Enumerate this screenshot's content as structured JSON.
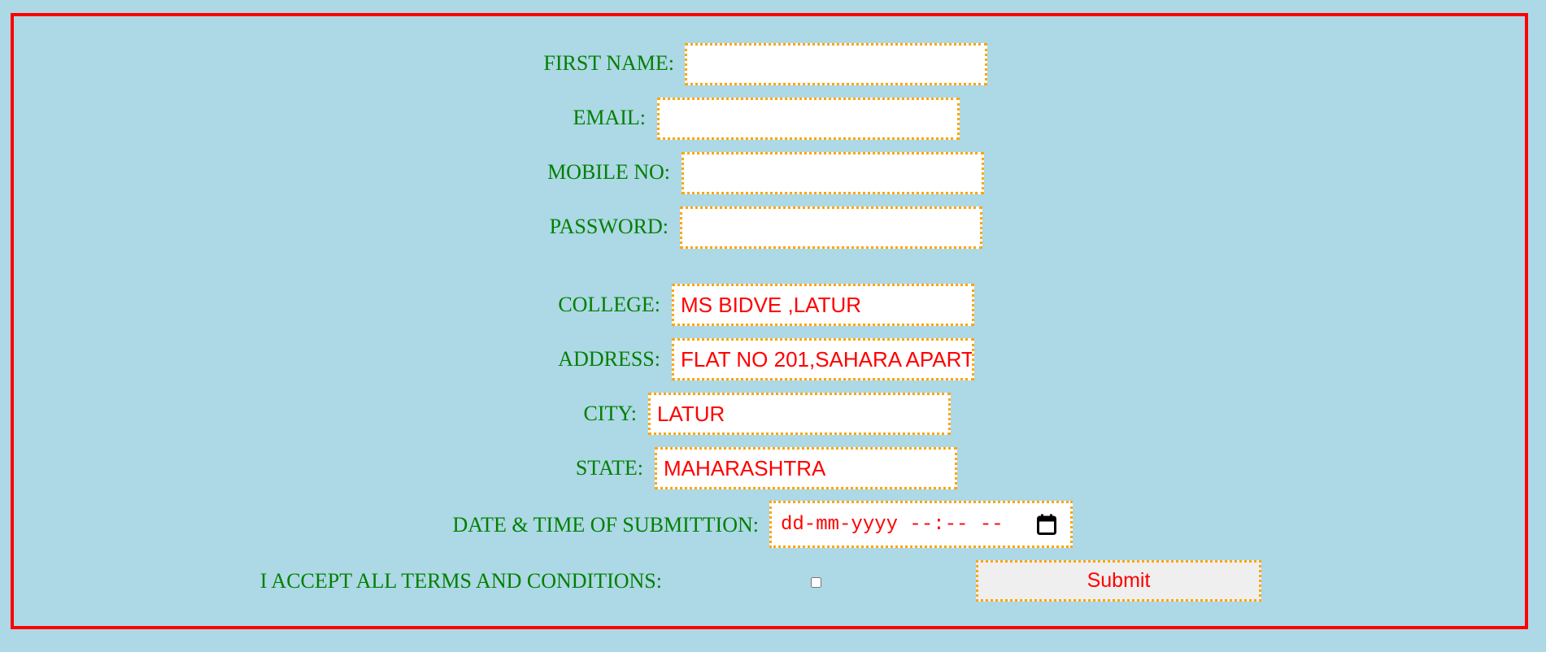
{
  "form": {
    "first_name": {
      "label": "FIRST NAME:",
      "value": ""
    },
    "email": {
      "label": "EMAIL:",
      "value": ""
    },
    "mobile_no": {
      "label": "MOBILE NO:",
      "value": ""
    },
    "password": {
      "label": "PASSWORD:",
      "value": ""
    },
    "college": {
      "label": "COLLEGE:",
      "value": "MS BIDVE ,LATUR"
    },
    "address": {
      "label": "ADDRESS:",
      "value": "FLAT NO 201,SAHARA APART"
    },
    "city": {
      "label": "CITY:",
      "value": "LATUR"
    },
    "state": {
      "label": "STATE:",
      "value": "MAHARASHTRA"
    },
    "datetime": {
      "label": "DATE & TIME OF SUBMITTION:",
      "placeholder": "dd-mm-yyyy --:-- --",
      "icon": "calendar-icon"
    },
    "terms": {
      "label": "I ACCEPT ALL TERMS AND CONDITIONS:",
      "checked": false
    },
    "submit_label": "Submit"
  },
  "colors": {
    "background": "#add8e6",
    "frame_border": "#ff0000",
    "label_text": "#008000",
    "value_text": "#ff0000",
    "field_border": "#ffa500"
  }
}
